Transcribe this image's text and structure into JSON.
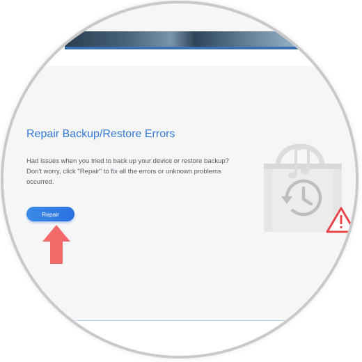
{
  "repair_section": {
    "title": "Repair Backup/Restore Errors",
    "description": "Had issues when you tried to back up your device or restore backup? Don't worry, click \"Repair\" to fix all the errors or unknown problems occurred.",
    "button_label": "Repair"
  },
  "icons": {
    "pointer": "red-up-arrow-icon",
    "illustration": "music-bag-restore-icon",
    "clock": "restore-clock-icon",
    "music_note": "music-note-icon",
    "warning": "warning-triangle-icon"
  },
  "colors": {
    "accent": "#3479d6",
    "button": "#2b6fe0",
    "arrow": "#f26a6a",
    "warning": "#e8454b",
    "illustration": "#dcdcdd"
  }
}
